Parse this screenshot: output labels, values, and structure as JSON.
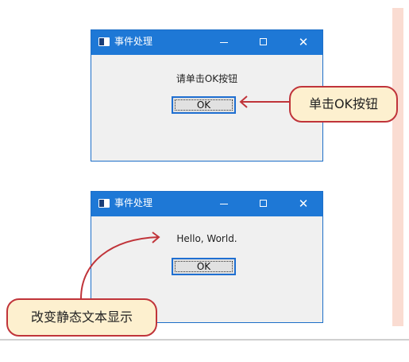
{
  "windows": [
    {
      "title": "事件处理",
      "static_text": "请单击OK按钮",
      "ok_button": "OK",
      "controls": {
        "minimize": "—",
        "maximize": "□",
        "close": "✕"
      }
    },
    {
      "title": "事件处理",
      "static_text": "Hello, World.",
      "ok_button": "OK",
      "controls": {
        "minimize": "—",
        "maximize": "□",
        "close": "✕"
      }
    }
  ],
  "callouts": {
    "click_ok": "单击OK按钮",
    "change_text": "改变静态文本显示"
  },
  "colors": {
    "titlebar": "#1e78d6",
    "callout_fill": "#fdf0cf",
    "callout_border": "#c0343a",
    "side_panel": "#fadcd2"
  }
}
